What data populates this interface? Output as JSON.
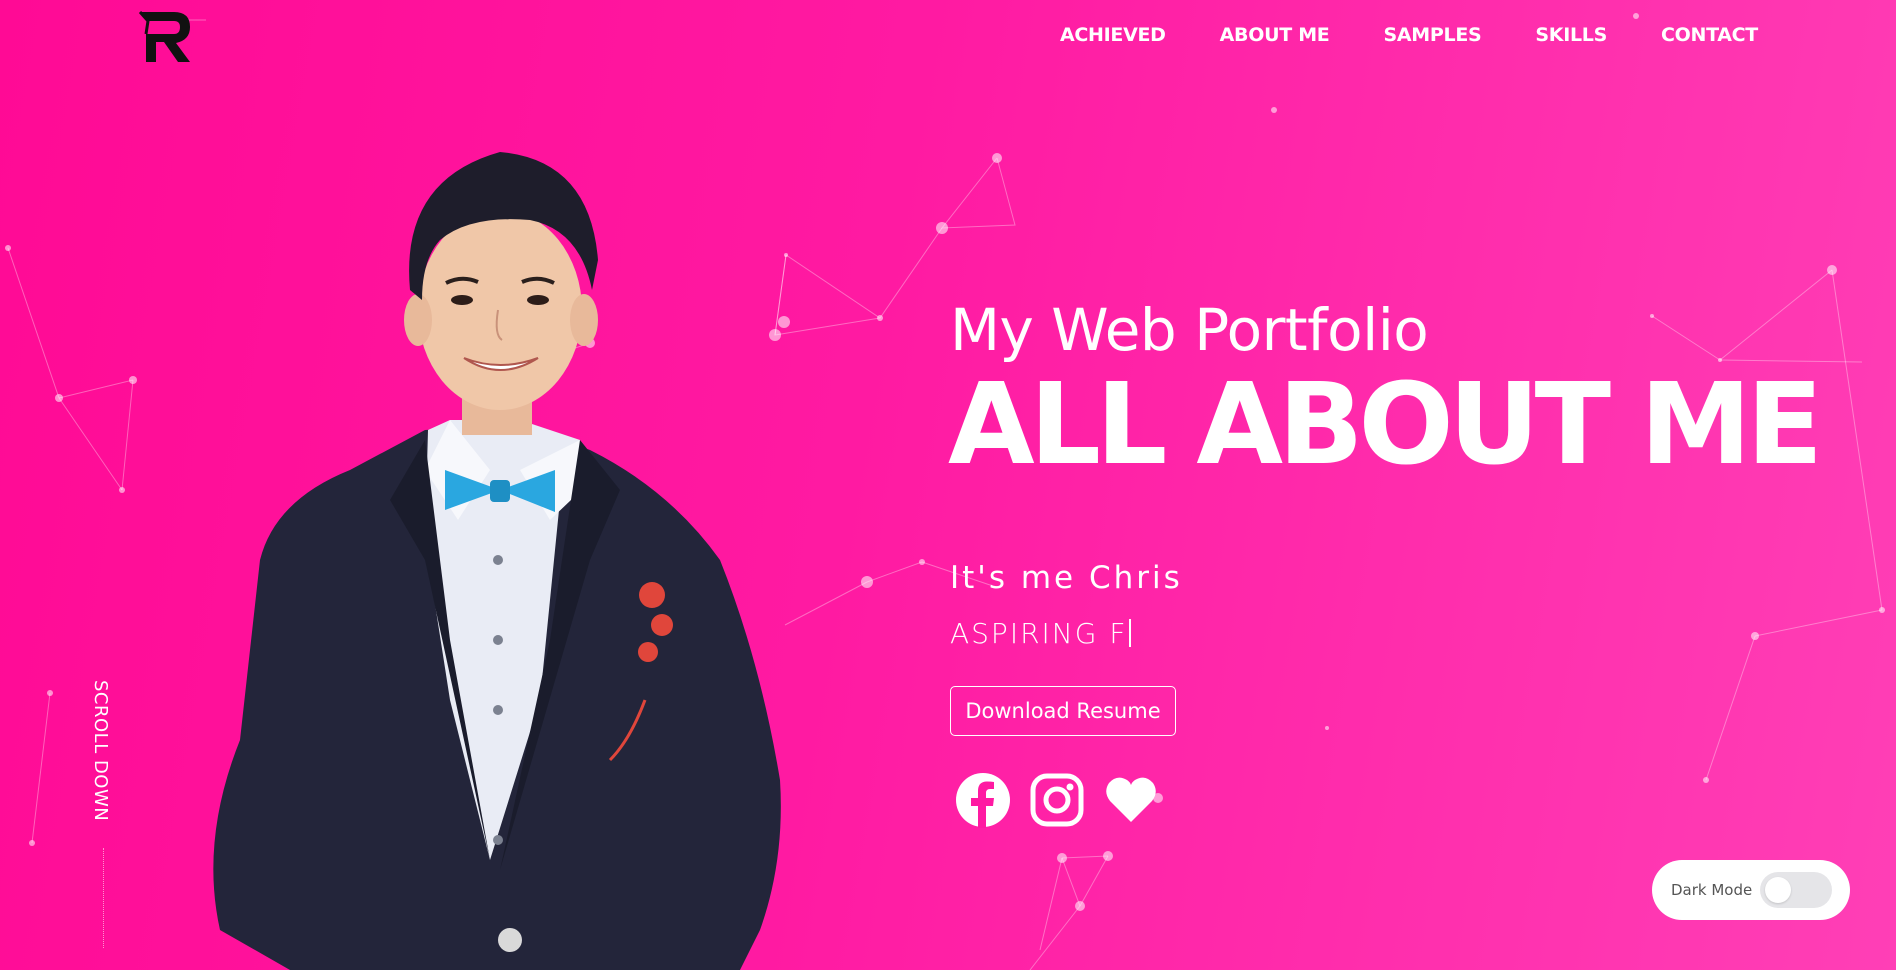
{
  "brand": {
    "logo_icon": "r-logo-icon"
  },
  "nav": {
    "items": [
      {
        "label": "ACHIEVED"
      },
      {
        "label": "ABOUT ME"
      },
      {
        "label": "SAMPLES"
      },
      {
        "label": "SKILLS"
      },
      {
        "label": "CONTACT"
      }
    ]
  },
  "hero": {
    "subtitle": "My Web Portfolio",
    "title": "ALL ABOUT ME",
    "greeting": "It's me Chris",
    "typing_text": "ASPIRING F",
    "resume_button": "Download Resume",
    "photo_icon": "profile-photo"
  },
  "social": [
    "facebook-icon",
    "instagram-icon",
    "heart-icon"
  ],
  "scroll": {
    "label": "SCROLL DOWN"
  },
  "dark_mode": {
    "label": "Dark Mode",
    "enabled": false
  },
  "colors": {
    "accent": "#ff1aa2",
    "text": "#ffffff",
    "toggle_track": "#e5e5e8"
  }
}
